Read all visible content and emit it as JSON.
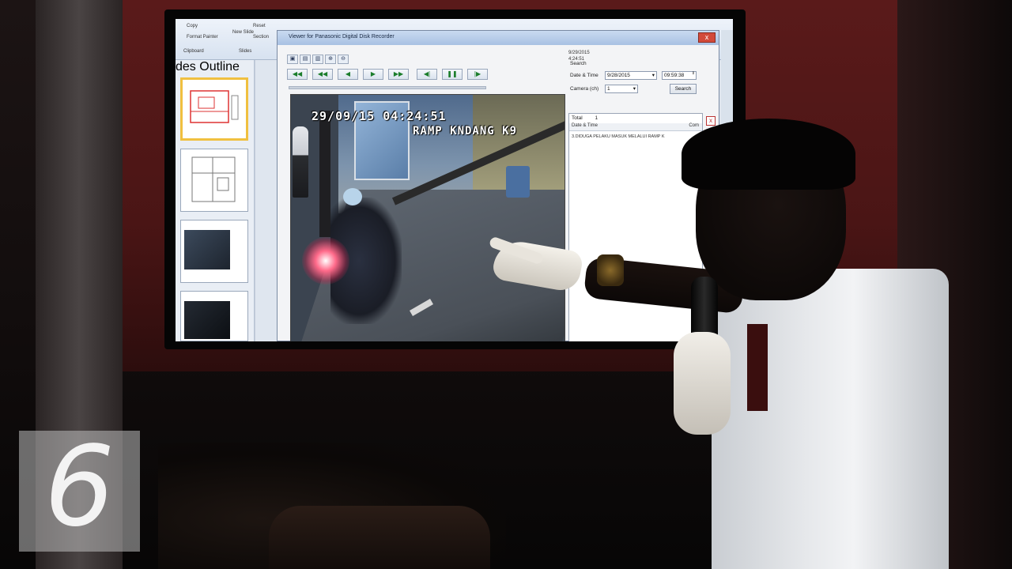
{
  "ppt": {
    "ribbon_items": [
      "Copy",
      "Format Painter",
      "New Slide",
      "Reset",
      "Section",
      "Clipboard",
      "Slides"
    ],
    "sidebar_tabs": [
      "des",
      "Outline"
    ]
  },
  "dvr": {
    "window_title": "Viewer for Panasonic Digital Disk Recorder",
    "close_glyph": "x",
    "top_date": "9/29/2015",
    "top_time": "4:24:51",
    "search_label": "Search",
    "date_time_label": "Date & Time",
    "date_value": "9/28/2015",
    "time_value": "09:59:38",
    "camera_label": "Camera (ch)",
    "camera_value": "1",
    "search_button": "Search",
    "total_label": "Total",
    "total_value": "1",
    "result_header": "Date & Time",
    "comment_button": "Com",
    "result_row": "3.DIDUGA PELAKU MASUK MELALUI RAMP K",
    "clear_glyph": "x"
  },
  "video": {
    "osd_datetime": "29/09/15  04:24:51",
    "osd_camera": "RAMP KNDANG K9"
  },
  "watermark": {
    "digit": "6"
  }
}
